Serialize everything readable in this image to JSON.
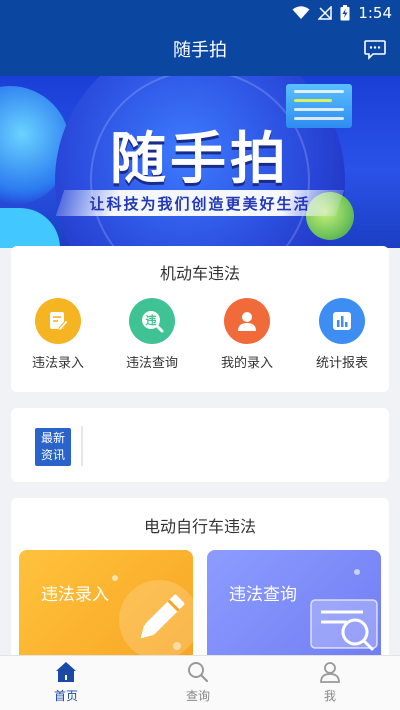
{
  "status_bar": {
    "time": "1:54"
  },
  "header": {
    "title": "随手拍",
    "message_icon": "chat-bubble-icon"
  },
  "banner": {
    "title": "随手拍",
    "slogan": "让科技为我们创造更美好生活"
  },
  "motor_section": {
    "title": "机动车违法",
    "items": [
      {
        "label": "违法录入",
        "icon": "edit-note-icon",
        "color": "#f5b422"
      },
      {
        "label": "违法查询",
        "icon": "violation-search-icon",
        "color": "#3fc394",
        "glyph": "违"
      },
      {
        "label": "我的录入",
        "icon": "user-icon",
        "color": "#f06a3a"
      },
      {
        "label": "统计报表",
        "icon": "bar-chart-icon",
        "color": "#3e8df2"
      }
    ]
  },
  "news": {
    "badge_line1": "最新",
    "badge_line2": "资讯"
  },
  "ebike_section": {
    "title": "电动自行车违法",
    "record_label": "违法录入",
    "query_label": "违法查询"
  },
  "bottom_nav": {
    "items": [
      {
        "label": "首页",
        "icon": "home-icon",
        "active": true
      },
      {
        "label": "查询",
        "icon": "search-icon",
        "active": false
      },
      {
        "label": "我",
        "icon": "person-icon",
        "active": false
      }
    ]
  },
  "colors": {
    "primary": "#0b47a0",
    "accent_active": "#1a4aa6"
  }
}
